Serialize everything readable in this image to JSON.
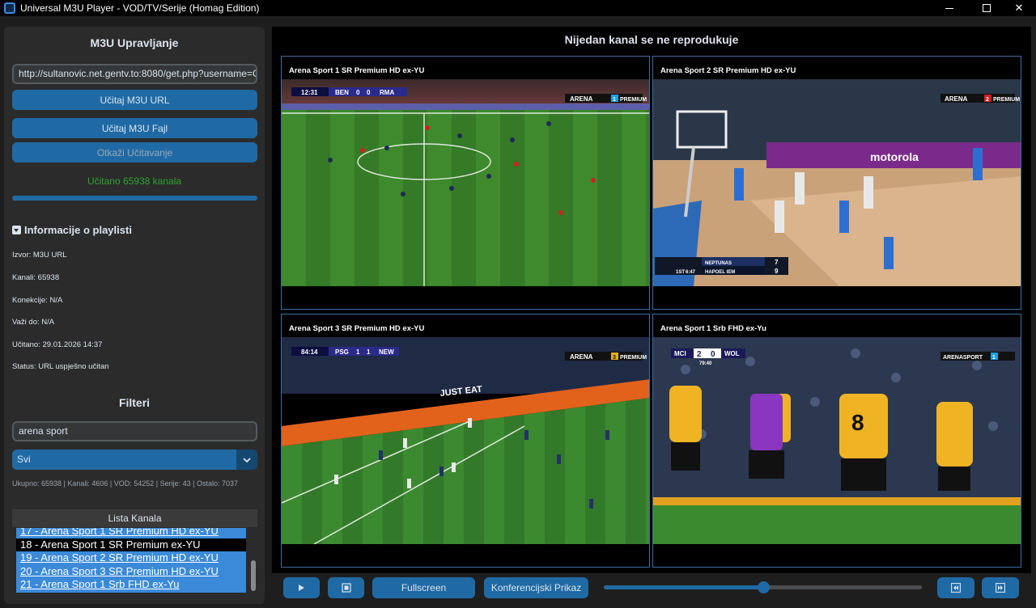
{
  "window": {
    "title": "Universal M3U Player - VOD/TV/Serije (Homag Edition)"
  },
  "sidebar": {
    "m3u_title": "M3U Upravljanje",
    "url_value": "http://sultanovic.net.gentv.to:8080/get.php?username=G",
    "load_url_label": "Učitaj M3U URL",
    "load_file_label": "Učitaj M3U Fajl",
    "cancel_label": "Otkaži Učitavanje",
    "loaded_status": "Učitano 65938 kanala",
    "progress_fraction": 1.0,
    "info_title": "Informacije o playlisti",
    "info": {
      "source": "Izvor: M3U URL",
      "channels": "Kanali: 65938",
      "connections": "Konekcije: N/A",
      "valid_until": "Važi do: N/A",
      "loaded_at": "Učitano: 29.01.2026 14:37",
      "status": "Status: URL uspješno učitan"
    },
    "filters_title": "Filteri",
    "search_value": "arena sport",
    "category_selected": "Svi",
    "stats": "Ukupno: 65938 | Kanali: 4606 | VOD: 54252 | Serije: 43 | Ostalo: 7037",
    "list_header": "Lista Kanala",
    "channels": [
      "17 - Arena Sport 1 SR Premium HD ex-YU",
      "18 - Arena Sport 1 SR Premium ex-YU",
      "19 - Arena Sport 2 SR Premium HD ex-YU",
      "20 - Arena Sport 3 SR Premium HD ex-YU",
      "21 - Arena Sport 1 Srb FHD ex-Yu"
    ],
    "selected_channel_index": 1
  },
  "main": {
    "now_playing": "Nijedan kanal se ne reprodukuje",
    "tiles": [
      {
        "label": "Arena Sport 1 SR Premium HD ex-YU",
        "clock": "12:31",
        "home": "BEN",
        "hs": "0",
        "as": "0",
        "away": "RMA",
        "brand": "ARENA",
        "num": "1",
        "tag": "PREMIUM"
      },
      {
        "label": "Arena Sport 2 SR Premium HD ex-YU",
        "brand": "ARENA",
        "num": "2",
        "tag": "PREMIUM",
        "sb_home": "NEPTUNAS",
        "sb_hs": "7",
        "sb_away": "HAPOEL IEM",
        "sb_as": "9",
        "sb_period": "1ST",
        "sb_time": "6:47",
        "court_text": "motorola"
      },
      {
        "label": "Arena Sport 3 SR Premium HD ex-YU",
        "clock": "84:14",
        "home": "PSG",
        "hs": "1",
        "as": "1",
        "away": "NEW",
        "brand": "ARENA",
        "num": "3",
        "tag": "PREMIUM",
        "board": "JUST EAT"
      },
      {
        "label": "Arena Sport 1 Srb FHD ex-Yu",
        "home": "MCI",
        "hs": "2",
        "as": "0",
        "away": "WOL",
        "clock": "79:40",
        "brand": "ARENASPORT",
        "num": "1",
        "shirt": "8"
      }
    ]
  },
  "controls": {
    "play_icon": "play-icon",
    "stop_icon": "stop-icon",
    "fullscreen_label": "Fullscreen",
    "conference_label": "Konferencijski Prikaz",
    "volume_fraction": 0.5,
    "prev_icon": "prev-icon",
    "next_icon": "next-icon"
  },
  "colors": {
    "accent": "#1f6aa5",
    "loaded_green": "#2fa52f",
    "list_bg": "#3b8ad9"
  }
}
